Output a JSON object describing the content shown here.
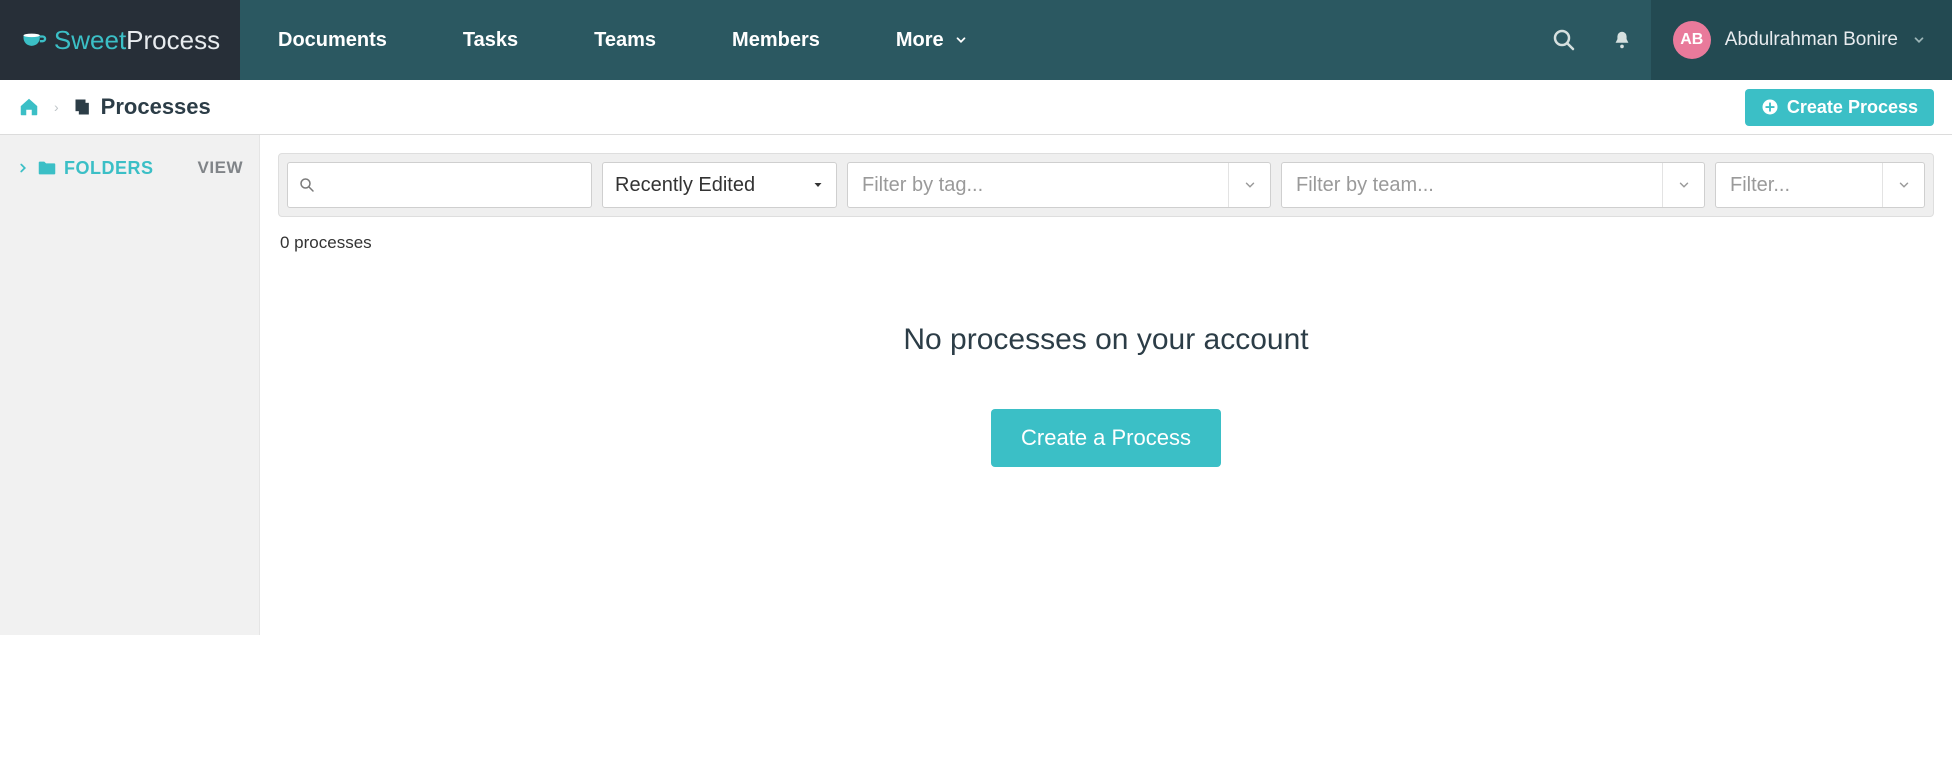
{
  "brand": {
    "sweet": "Sweet",
    "process": "Process"
  },
  "nav": {
    "documents": "Documents",
    "tasks": "Tasks",
    "teams": "Teams",
    "members": "Members",
    "more": "More"
  },
  "user": {
    "initials": "AB",
    "name": "Abdulrahman Bonire"
  },
  "breadcrumb": {
    "title": "Processes",
    "create": "Create Process"
  },
  "sidebar": {
    "folders": "FOLDERS",
    "view": "VIEW"
  },
  "filters": {
    "sort_selected": "Recently Edited",
    "tag_placeholder": "Filter by tag...",
    "team_placeholder": "Filter by team...",
    "generic_placeholder": "Filter..."
  },
  "list": {
    "count_text": "0 processes"
  },
  "empty": {
    "title": "No processes on your account",
    "button": "Create a Process"
  }
}
